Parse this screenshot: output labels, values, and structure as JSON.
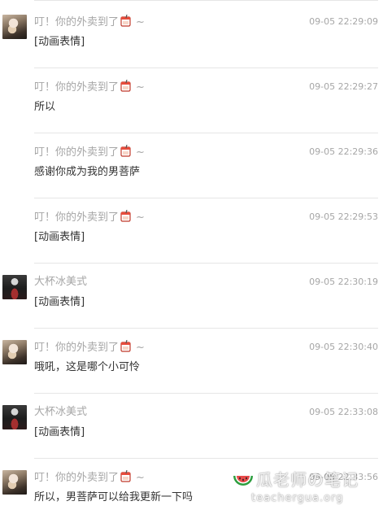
{
  "messages": [
    {
      "name": "叮！你的外卖到了",
      "name_suffix": "~",
      "avatar": "avatar-girl",
      "time": "09-05 22:29:09",
      "text": "[动画表情]"
    },
    {
      "name": "叮！你的外卖到了",
      "name_suffix": "~",
      "avatar": "",
      "time": "09-05 22:29:27",
      "text": "所以"
    },
    {
      "name": "叮！你的外卖到了",
      "name_suffix": "~",
      "avatar": "",
      "time": "09-05 22:29:36",
      "text": "感谢你成为我的男菩萨"
    },
    {
      "name": "叮！你的外卖到了",
      "name_suffix": "~",
      "avatar": "",
      "time": "09-05 22:29:53",
      "text": "[动画表情]"
    },
    {
      "name": "大杯冰美式",
      "name_suffix": "",
      "avatar": "avatar-dark",
      "time": "09-05 22:30:19",
      "text": "[动画表情]"
    },
    {
      "name": "叮！你的外卖到了",
      "name_suffix": "~",
      "avatar": "avatar-girl",
      "time": "09-05 22:30:40",
      "text": "哦吼，这是哪个小可怜"
    },
    {
      "name": "大杯冰美式",
      "name_suffix": "",
      "avatar": "avatar-dark",
      "time": "09-05 22:33:08",
      "text": "[动画表情]"
    },
    {
      "name": "叮！你的外卖到了",
      "name_suffix": "~",
      "avatar": "avatar-girl",
      "time": "09-05 22:33:56",
      "text": "所以，男菩萨可以给我更新一下吗"
    }
  ],
  "name_emoji_icon": "bubble-tea-cup-icon",
  "watermark": {
    "title": "瓜老师の笔记",
    "url": "teachergua.org",
    "logo_icon": "watermelon-icon"
  },
  "colors": {
    "meta_text": "#a6a6a6",
    "body_text": "#333333",
    "separator": "#e6e6e6"
  }
}
